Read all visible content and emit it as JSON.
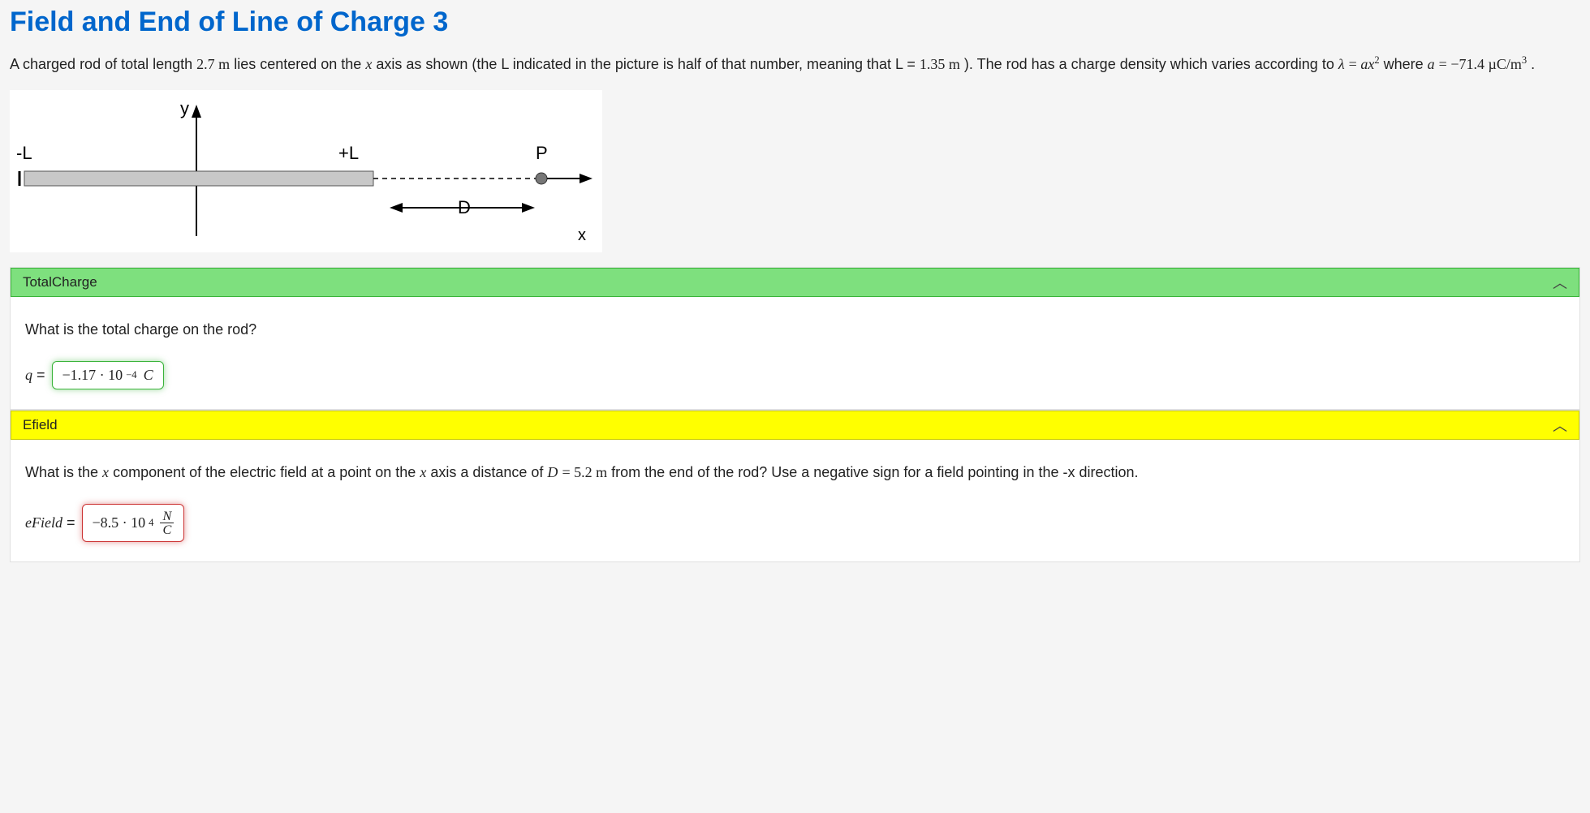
{
  "title": "Field and End of Line of Charge 3",
  "problem": {
    "intro1": "A charged rod of total length ",
    "total_length": "2.7 m",
    "intro2": " lies centered on the ",
    "axis_var": "x",
    "intro3": " axis as shown (the L indicated in the picture is half of that number, meaning that L = ",
    "half_length": "1.35 m",
    "intro4": "). The rod has a charge density which varies according to ",
    "lambda_eq_lhs": "λ",
    "lambda_eq_rhs": "ax",
    "lambda_exp": "2",
    "intro5": " where ",
    "a_var": "a",
    "a_value": "−71.4 µC/m",
    "a_exp": "3",
    "intro6": "."
  },
  "diagram": {
    "neg_L": "-L",
    "pos_L": "+L",
    "P": "P",
    "D": "D",
    "x": "x",
    "y": "y"
  },
  "sections": {
    "total_charge": {
      "header": "TotalCharge",
      "question": "What is the total charge on the rod?",
      "lhs_var": "q",
      "answer_value": "−1.17 · 10",
      "answer_exp": "−4",
      "answer_unit": "C"
    },
    "efield": {
      "header": "Efield",
      "q_part1": "What is the ",
      "q_var1": "x",
      "q_part2": " component of the electric field at a point on the ",
      "q_var2": "x",
      "q_part3": " axis a distance of ",
      "D_var": "D",
      "D_value": "5.2 m",
      "q_part4": " from the end of the rod? Use a negative sign for a field pointing in the -x direction.",
      "lhs_var": "eField",
      "answer_value": "−8.5 · 10",
      "answer_exp": "4",
      "unit_num": "N",
      "unit_den": "C"
    }
  }
}
